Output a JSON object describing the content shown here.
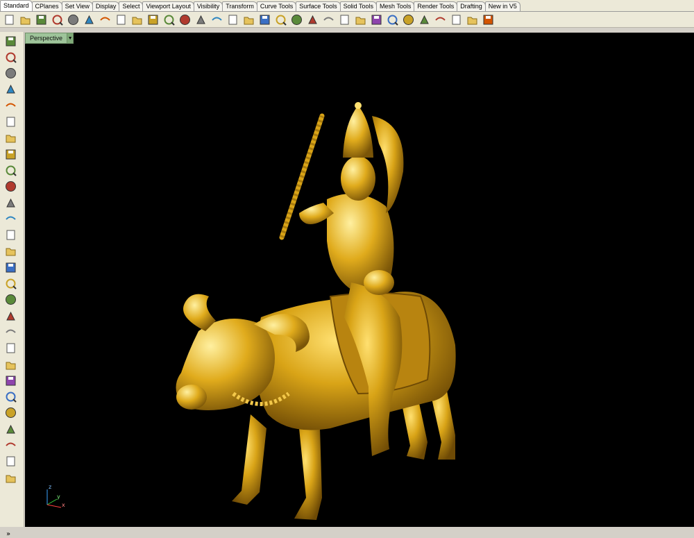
{
  "tabs": [
    {
      "label": "Standard",
      "active": true
    },
    {
      "label": "CPlanes"
    },
    {
      "label": "Set View"
    },
    {
      "label": "Display"
    },
    {
      "label": "Select"
    },
    {
      "label": "Viewport Layout"
    },
    {
      "label": "Visibility"
    },
    {
      "label": "Transform"
    },
    {
      "label": "Curve Tools"
    },
    {
      "label": "Surface Tools"
    },
    {
      "label": "Solid Tools"
    },
    {
      "label": "Mesh Tools"
    },
    {
      "label": "Render Tools"
    },
    {
      "label": "Drafting"
    },
    {
      "label": "New in V5"
    }
  ],
  "toolbar_icons": [
    "new-file-icon",
    "open-folder-icon",
    "save-icon",
    "print-icon",
    "paste-document-icon",
    "cut-icon",
    "copy-icon",
    "clipboard-icon",
    "undo-icon",
    "pan-hand-icon",
    "move-icon",
    "zoom-icon",
    "zoom-window-icon",
    "zoom-extents-icon",
    "zoom-selected-icon",
    "rotate-view-icon",
    "four-viewports-icon",
    "car-icon",
    "hide-icon",
    "lock-icon",
    "lightbulb-icon",
    "padlock-icon",
    "material-icon",
    "color-wheel-icon",
    "shaded-sphere-icon",
    "render-sphere-icon",
    "environment-sphere-icon",
    "light-icon",
    "options-gear-icon",
    "dimension-icon",
    "help-icon"
  ],
  "left_icons": [
    "select-arrow-icon",
    "point-icon",
    "polyline-icon",
    "curve-icon",
    "circle-icon",
    "ellipse-icon",
    "arc-icon",
    "rectangle-icon",
    "polygon-icon",
    "fillet-icon",
    "surface-icon",
    "extrude-icon",
    "box-icon",
    "spheres-icon",
    "cylinder-icon",
    "plane-icon",
    "explode-icon",
    "boolean-icon",
    "trim-icon",
    "join-icon",
    "group-icon",
    "array-icon",
    "offset-icon",
    "text-icon",
    "scale-icon",
    "transform-icon",
    "block-icon",
    "solid-box-icon"
  ],
  "more_label": "»",
  "viewport": {
    "label": "Perspective",
    "background": "#000000",
    "axes": {
      "z": "z",
      "y": "y",
      "x": "x"
    }
  },
  "colors": {
    "gold": "#d9a417",
    "gold_dark": "#7a5508",
    "viewport_tab": "#9ec49a"
  }
}
